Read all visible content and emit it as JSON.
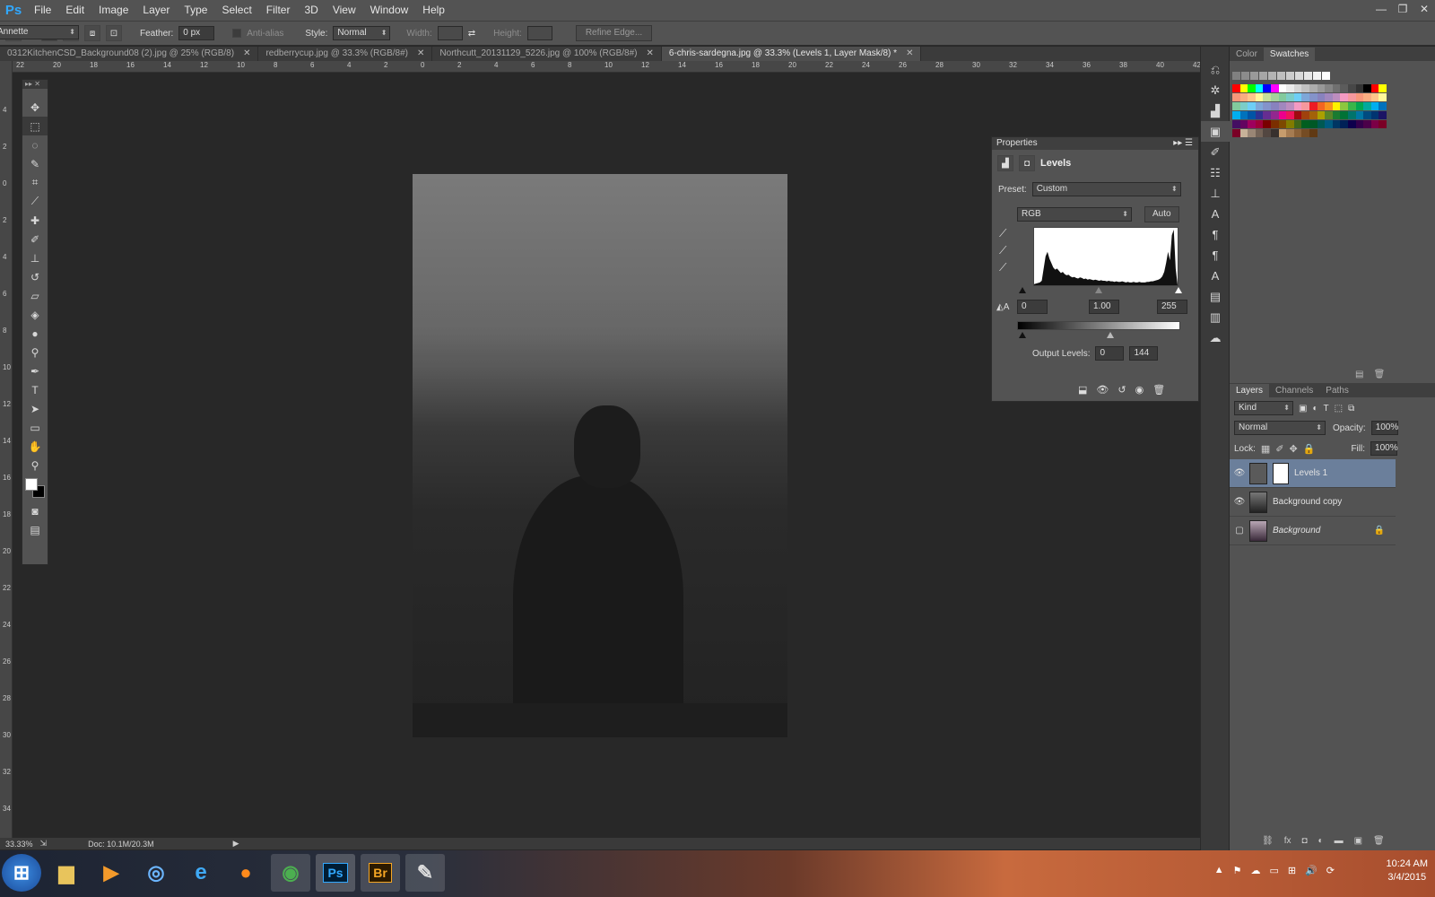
{
  "app": {
    "logo": "Ps"
  },
  "menu": [
    "File",
    "Edit",
    "Image",
    "Layer",
    "Type",
    "Select",
    "Filter",
    "3D",
    "View",
    "Window",
    "Help"
  ],
  "window_controls": [
    "—",
    "❐",
    "✕"
  ],
  "options": {
    "feather_label": "Feather:",
    "feather_value": "0 px",
    "antialias_label": "Anti-alias",
    "style_label": "Style:",
    "style_value": "Normal",
    "width_label": "Width:",
    "height_label": "Height:",
    "refine_label": "Refine Edge...",
    "workspace": "Annette"
  },
  "tabs": [
    {
      "label": "0312KitchenCSD_Background08 (2).jpg @ 25% (RGB/8)"
    },
    {
      "label": "redberrycup.jpg @ 33.3% (RGB/8#)"
    },
    {
      "label": "Northcutt_20131129_5226.jpg @ 100% (RGB/8#)"
    },
    {
      "label": "6-chris-sardegna.jpg @ 33.3% (Levels 1, Layer Mask/8) *"
    }
  ],
  "hruler_labels": [
    "22",
    "20",
    "18",
    "16",
    "14",
    "12",
    "10",
    "8",
    "6",
    "4",
    "2",
    "0",
    "2",
    "4",
    "6",
    "8",
    "10",
    "12",
    "14",
    "16",
    "18",
    "20",
    "22",
    "24",
    "26",
    "28",
    "30",
    "32",
    "34",
    "36",
    "38",
    "40",
    "42"
  ],
  "vruler_labels": [
    "4",
    "2",
    "0",
    "2",
    "4",
    "6",
    "8",
    "10",
    "12",
    "14",
    "16",
    "18",
    "20",
    "22",
    "24",
    "26",
    "28",
    "30",
    "32",
    "34"
  ],
  "status": {
    "zoom": "33.33%",
    "doc": "Doc: 10.1M/20.3M"
  },
  "properties": {
    "title": "Properties",
    "adjustment": "Levels",
    "preset_label": "Preset:",
    "preset_value": "Custom",
    "channel": "RGB",
    "auto_label": "Auto",
    "input_black": "0",
    "input_gamma": "1.00",
    "input_white": "255",
    "output_label": "Output Levels:",
    "output_black": "0",
    "output_white": "144",
    "histogram": [
      2,
      3,
      4,
      5,
      8,
      30,
      52,
      60,
      48,
      40,
      32,
      28,
      30,
      26,
      22,
      24,
      20,
      18,
      19,
      16,
      14,
      15,
      13,
      12,
      14,
      13,
      11,
      12,
      10,
      11,
      10,
      9,
      10,
      9,
      8,
      9,
      8,
      8,
      7,
      8,
      7,
      7,
      6,
      7,
      6,
      6,
      7,
      6,
      5,
      6,
      5,
      5,
      6,
      5,
      5,
      6,
      5,
      5,
      5,
      6,
      6,
      7,
      7,
      8,
      9,
      10,
      12,
      16,
      24,
      40,
      60,
      45,
      90,
      100,
      30
    ]
  },
  "panels": {
    "color_tabs": [
      "Color",
      "Swatches"
    ],
    "layer_tabs": [
      "Layers",
      "Channels",
      "Paths"
    ],
    "kind_label": "Kind",
    "blend_mode": "Normal",
    "opacity_label": "Opacity:",
    "opacity_value": "100%",
    "lock_label": "Lock:",
    "fill_label": "Fill:",
    "fill_value": "100%",
    "layers": [
      {
        "name": "Levels 1"
      },
      {
        "name": "Background copy"
      },
      {
        "name": "Background"
      }
    ]
  },
  "swatch_colors": [
    [
      "#ff0000",
      "#ffff00",
      "#00ff00",
      "#00ffff",
      "#0000ff",
      "#ff00ff",
      "#ffffff",
      "#ebebeb",
      "#d6d6d6",
      "#c2c2c2",
      "#adadad",
      "#999999",
      "#858585",
      "#707070",
      "#5c5c5c",
      "#474747",
      "#333333",
      "#000000",
      "#ff0000",
      "#ffff00"
    ],
    [
      "#f7977a",
      "#f9ad81",
      "#fdc68a",
      "#fff79a",
      "#c4df9b",
      "#a3d39c",
      "#82ca9d",
      "#7bcdc8",
      "#6ecff6",
      "#7ea7d8",
      "#8493ca",
      "#8882be",
      "#a187be",
      "#bc8dbf",
      "#f49ac2",
      "#f6989d",
      "#f7977a",
      "#f9ad81",
      "#fdc68a",
      "#fff79a"
    ],
    [
      "#82ca9d",
      "#7bcdc8",
      "#6ecff6",
      "#7ea7d8",
      "#8493ca",
      "#8882be",
      "#a187be",
      "#bc8dbf",
      "#f49ac2",
      "#f6989d",
      "#ed1c24",
      "#f26522",
      "#f7941d",
      "#fff200",
      "#8dc73f",
      "#39b54a",
      "#00a651",
      "#00a99d",
      "#00aeef",
      "#0072bc"
    ],
    [
      "#00aeef",
      "#0072bc",
      "#0054a6",
      "#2e3192",
      "#662d91",
      "#92278f",
      "#ec008c",
      "#ed145b",
      "#9e0b0f",
      "#a0410d",
      "#a36209",
      "#aba000",
      "#598527",
      "#1a7b30",
      "#007236",
      "#00746b",
      "#0076a3",
      "#004b80",
      "#003471",
      "#1b1464"
    ],
    [
      "#440e62",
      "#630460",
      "#9e005d",
      "#9e0039",
      "#790000",
      "#7b2e00",
      "#7d4900",
      "#827b00",
      "#406618",
      "#005e20",
      "#005826",
      "#005952",
      "#005b7f",
      "#003663",
      "#002157",
      "#0d004c",
      "#32004b",
      "#4b0049",
      "#7b0046",
      "#7a0026"
    ],
    [
      "#7a0026",
      "#c7b299",
      "#998675",
      "#736357",
      "#534741",
      "#37302d",
      "#c69c6d",
      "#a67c52",
      "#8c6239",
      "#754c24",
      "#603913"
    ]
  ],
  "taskbar": {
    "apps": [
      "start-orb",
      "explorer",
      "media-player",
      "network",
      "internet-explorer",
      "firefox",
      "chrome",
      "photoshop",
      "bridge",
      "paint"
    ],
    "ps_label": "Ps",
    "br_label": "Br",
    "time": "10:24 AM",
    "date": "3/4/2015"
  }
}
